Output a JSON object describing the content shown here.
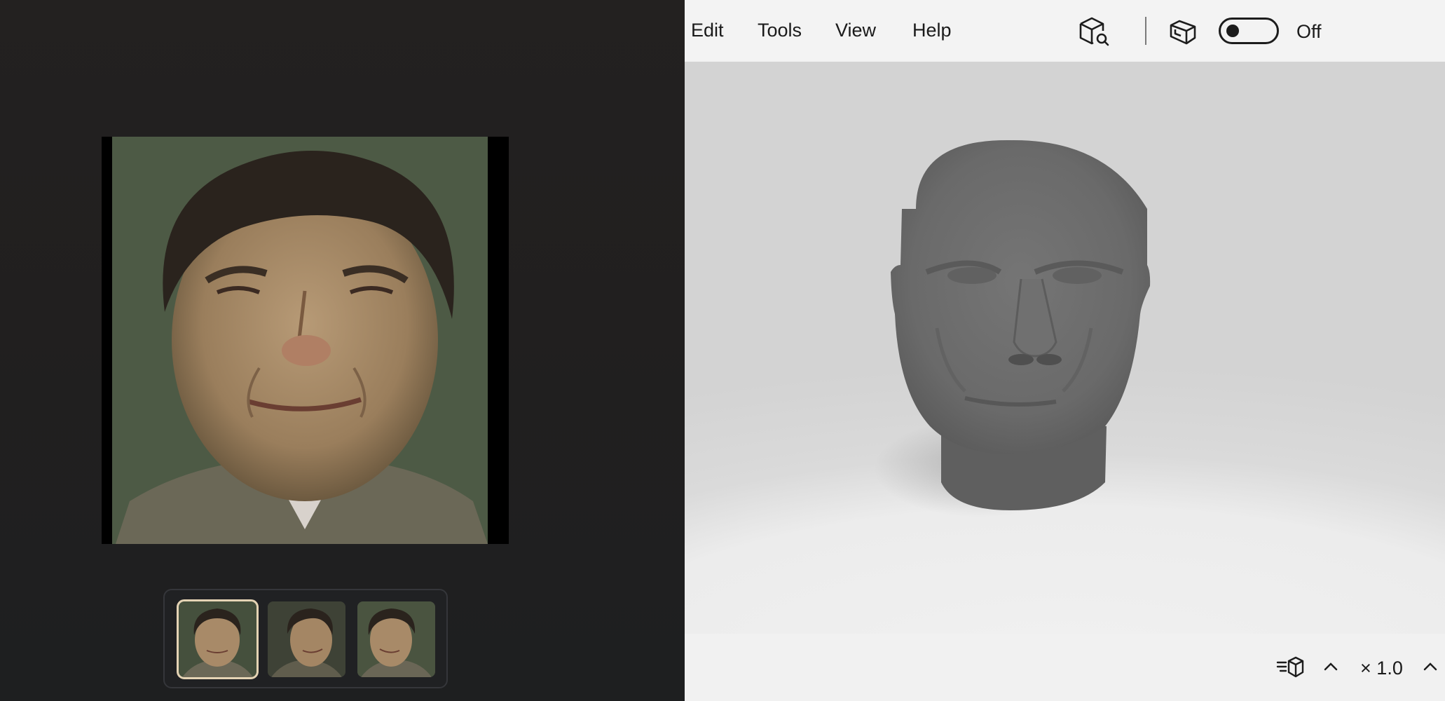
{
  "menu": {
    "edit": "Edit",
    "tools": "Tools",
    "view": "View",
    "help": "Help"
  },
  "toolbar": {
    "inspect_icon": "cube-search-icon",
    "view3d_icon": "cube-view-icon",
    "toggle_state": "off",
    "toggle_label": "Off"
  },
  "statusbar": {
    "render_icon": "render-mode-icon",
    "zoom_prefix": "×",
    "zoom_value": "1.0"
  },
  "thumbnails": [
    {
      "pose": "front",
      "selected": true
    },
    {
      "pose": "three-quarter-left",
      "selected": false
    },
    {
      "pose": "three-quarter-right",
      "selected": false
    }
  ],
  "colors": {
    "left_bg": "#222020",
    "right_bg": "#f3f3f3",
    "thumb_selected_border": "#e4d3b4",
    "mesh_gray": "#6a6a6a"
  }
}
